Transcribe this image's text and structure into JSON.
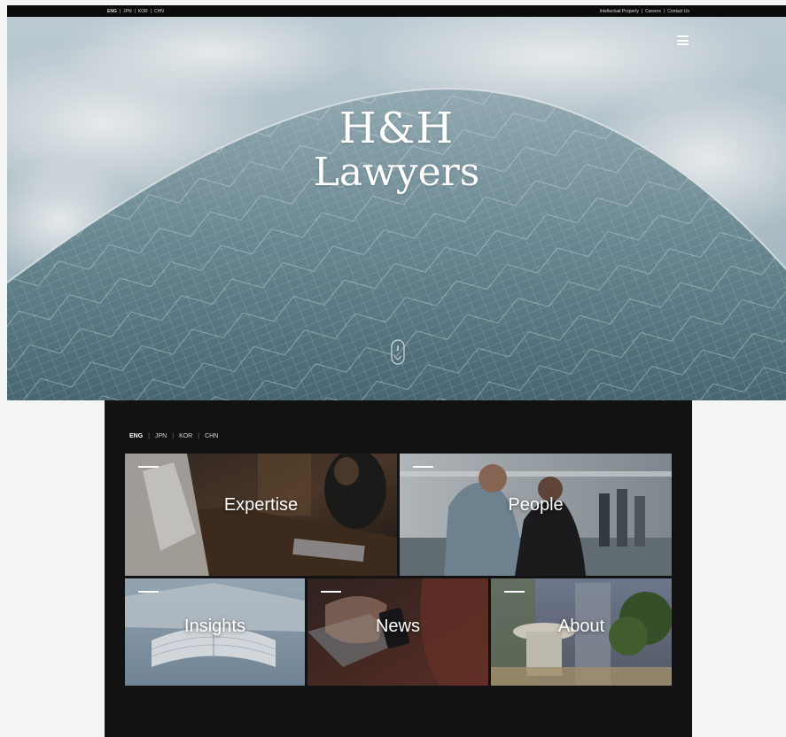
{
  "top_bar": {
    "languages": [
      "ENG",
      "JPN",
      "KOR",
      "CHN"
    ],
    "active_language": "ENG",
    "links": [
      "Intellectual Property",
      "Careers",
      "Contact Us"
    ]
  },
  "hero": {
    "title_line1": "H&H",
    "title_line2": "Lawyers",
    "menu_icon": "hamburger-icon",
    "scroll_icon": "scroll-down-icon"
  },
  "menu_panel": {
    "languages": [
      "ENG",
      "JPN",
      "KOR",
      "CHN"
    ],
    "active_language": "ENG",
    "tiles": [
      {
        "label": "Expertise"
      },
      {
        "label": "People"
      },
      {
        "label": "Insights"
      },
      {
        "label": "News"
      },
      {
        "label": "About"
      }
    ]
  },
  "colors": {
    "panel_background": "#121212",
    "top_bar_background": "#0b0b0b",
    "text": "#ffffff"
  }
}
